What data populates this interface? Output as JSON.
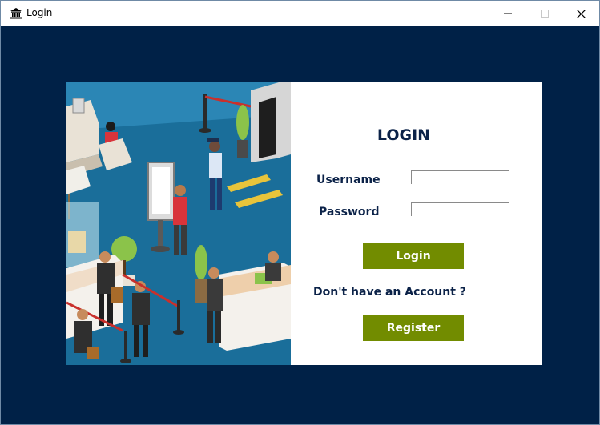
{
  "window": {
    "title": "Login",
    "app_icon": "bank-icon",
    "controls": [
      "minimize-icon",
      "maximize-icon",
      "close-icon"
    ]
  },
  "colors": {
    "background": "#002147",
    "accent_button": "#728c00",
    "heading_text": "#0b2248"
  },
  "illustration": {
    "icon": "office-reception-illustration"
  },
  "form": {
    "heading": "LOGIN",
    "username_label": "Username",
    "username_value": "",
    "password_label": "Password",
    "password_value": "",
    "login_button": "Login",
    "no_account_text": "Don't have an Account ?",
    "register_button": "Register"
  }
}
